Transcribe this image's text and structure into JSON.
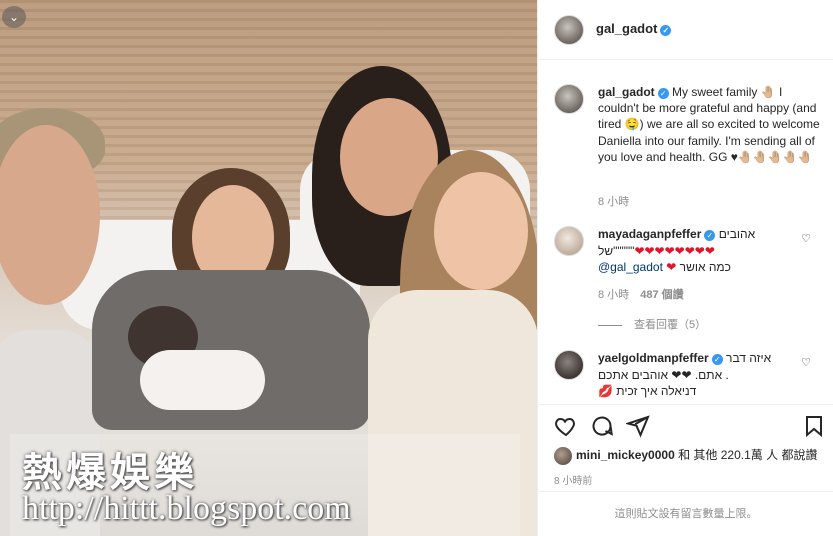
{
  "photo": {
    "badge_icon": "chevron-down-icon",
    "watermark_title": "熱爆娛樂",
    "watermark_url": "http://hittt.blogspot.com"
  },
  "header": {
    "username": "gal_gadot",
    "verified_icon": "verified-badge-icon"
  },
  "caption": {
    "username": "gal_gadot",
    "text_1": "My sweet family ",
    "emoji_1": "🤚🏼",
    "text_2": " I couldn't be more grateful and happy (and tired ",
    "emoji_2": "🤤",
    "text_3": ") we are all so excited to welcome Daniella into our family. I'm sending all of you love and health. GG ",
    "emoji_3": "♥🤚🏼🤚🏼🤚🏼🤚🏼🤚🏼",
    "time": "8 小時"
  },
  "comments": [
    {
      "username": "mayadaganpfeffer",
      "text_he": "אהובים",
      "line2_pre": "של\"\"\"\"\"",
      "hearts": "❤❤❤❤❤❤❤❤",
      "line3_he": "כמה אושר",
      "line3_heart": "❤",
      "mention": "@gal_gadot",
      "time": "8 小時",
      "likes": "487 個讚"
    },
    {
      "username": "yaelgoldmanpfeffer",
      "text_he": "איזה דבר",
      "line2": "אתם. ❤❤ אוהבים אתכם .",
      "line3": "💋 דניאלה איך זכית",
      "time": ""
    }
  ],
  "view_replies": "查看回覆（5）",
  "likes_line": {
    "user": "mini_mickey0000",
    "rest": " 和 其他 220.1萬 人 都說讚"
  },
  "time_ago": "8 小時前",
  "footer": "這則貼文設有留言數量上限。"
}
